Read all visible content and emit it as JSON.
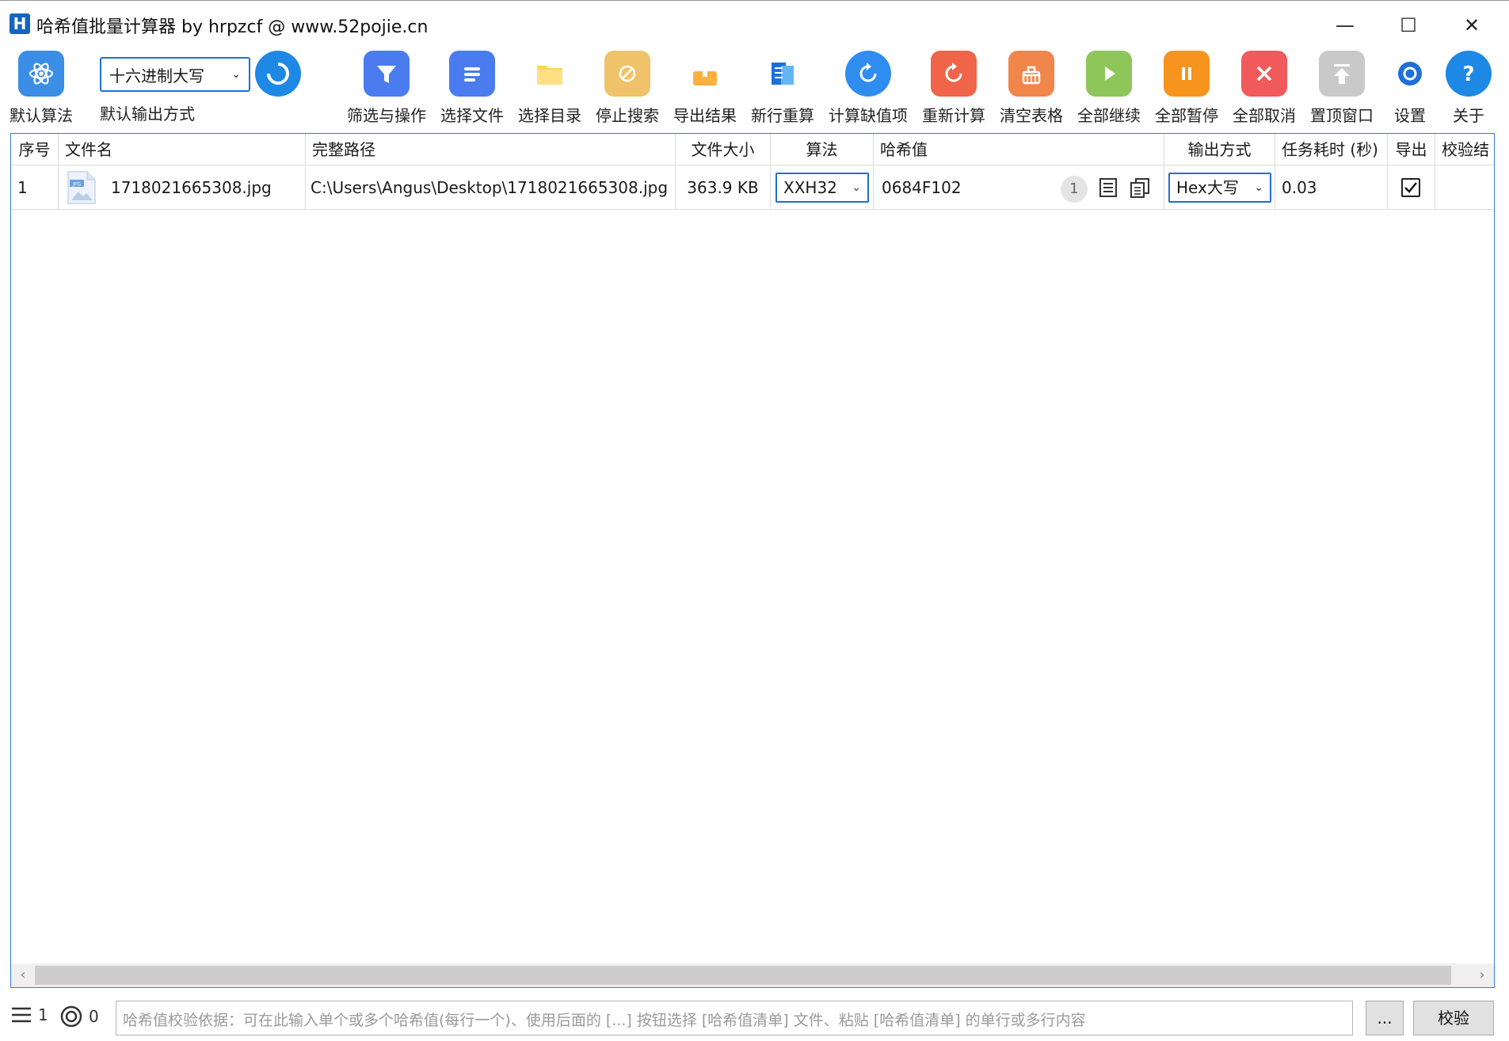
{
  "window": {
    "icon_letter": "H",
    "title": "哈希值批量计算器 by hrpzcf @ www.52pojie.cn",
    "minimize": "—",
    "maximize": "☐",
    "close": "✕"
  },
  "toolbar": {
    "default_algorithm": "默认算法",
    "output_format_value": "十六进制大写",
    "output_format_label": "默认输出方式",
    "buttons": [
      {
        "label": "筛选与操作",
        "icon": "filter-icon",
        "color": "#4a7cf0"
      },
      {
        "label": "选择文件",
        "icon": "file-list-icon",
        "color": "#4a7cf0"
      },
      {
        "label": "选择目录",
        "icon": "folder-icon",
        "color": "#ffcc33"
      },
      {
        "label": "停止搜索",
        "icon": "stop-search-icon",
        "color": "#f0c36a"
      },
      {
        "label": "导出结果",
        "icon": "export-icon",
        "color": "#f7b500"
      },
      {
        "label": "新行重算",
        "icon": "new-row-icon",
        "color": "#2a7fe8"
      },
      {
        "label": "计算缺值项",
        "icon": "calc-missing-icon",
        "color": "#2f8df0"
      },
      {
        "label": "重新计算",
        "icon": "recalculate-icon",
        "color": "#f0654a"
      },
      {
        "label": "清空表格",
        "icon": "clear-table-icon",
        "color": "#f0864a"
      },
      {
        "label": "全部继续",
        "icon": "play-icon",
        "color": "#8ec65a"
      },
      {
        "label": "全部暂停",
        "icon": "pause-icon",
        "color": "#f7941d"
      },
      {
        "label": "全部取消",
        "icon": "cancel-icon",
        "color": "#f05a5a"
      },
      {
        "label": "置顶窗口",
        "icon": "pin-top-icon",
        "color": "#c9c9c9"
      },
      {
        "label": "设置",
        "icon": "gear-icon",
        "color": "#1e6fd9"
      },
      {
        "label": "关于",
        "icon": "help-icon",
        "color": "#1e88e5"
      }
    ]
  },
  "table": {
    "headers": [
      "序号",
      "文件名",
      "完整路径",
      "文件大小",
      "算法",
      "哈希值",
      "输出方式",
      "任务耗时 (秒)",
      "导出",
      "校验结"
    ],
    "rows": [
      {
        "index": "1",
        "filename": "1718021665308.jpg",
        "path": "C:\\Users\\Angus\\Desktop\\1718021665308.jpg",
        "size": "363.9 KB",
        "algorithm": "XXH32",
        "hash": "0684F102",
        "hash_count": "1",
        "output_format": "Hex大写",
        "elapsed": "0.03",
        "export_checked": true,
        "file_icon_text": "JPG"
      }
    ]
  },
  "statusbar": {
    "row_count": "1",
    "verified_count": "0",
    "verify_placeholder": "哈希值校验依据：可在此输入单个或多个哈希值(每行一个)、使用后面的 [...] 按钮选择 [哈希值清单] 文件、粘贴 [哈希值清单] 的单行或多行内容",
    "browse_label": "...",
    "verify_label": "校验"
  }
}
